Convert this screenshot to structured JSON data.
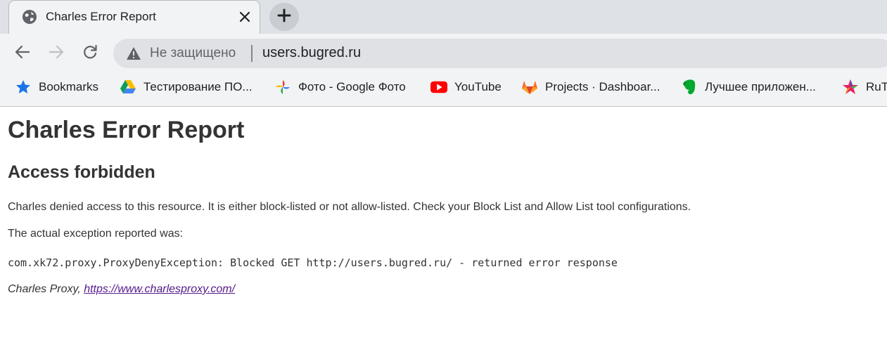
{
  "tab": {
    "title": "Charles Error Report",
    "favicon": "globe-icon",
    "close_icon": "close-icon"
  },
  "new_tab": {
    "icon": "plus-icon"
  },
  "toolbar": {
    "back_icon": "back-arrow-icon",
    "forward_icon": "forward-arrow-icon",
    "reload_icon": "reload-icon"
  },
  "omnibox": {
    "security_icon": "warning-triangle-icon",
    "security_label": "Не защищено",
    "url": "users.bugred.ru"
  },
  "bookmarks": [
    {
      "label": "Bookmarks",
      "icon": "star-icon"
    },
    {
      "label": "Тестирование ПО...",
      "icon": "google-drive-icon"
    },
    {
      "label": "Фото - Google Фото",
      "icon": "google-photos-icon"
    },
    {
      "label": "YouTube",
      "icon": "youtube-icon"
    },
    {
      "label": "Projects · Dashboar...",
      "icon": "gitlab-icon"
    },
    {
      "label": "Лучшее приложен...",
      "icon": "evernote-icon"
    },
    {
      "label": "RuTr",
      "icon": "rutracker-icon"
    }
  ],
  "page": {
    "title": "Charles Error Report",
    "heading": "Access forbidden",
    "message": "Charles denied access to this resource. It is either block-listed or not allow-listed. Check your Block List and Allow List tool configurations.",
    "exception_intro": "The actual exception reported was:",
    "exception": "com.xk72.proxy.ProxyDenyException: Blocked GET http://users.bugred.ru/ - returned error response",
    "footer_prefix": "Charles Proxy, ",
    "footer_link": "https://www.charlesproxy.com/"
  },
  "colors": {
    "tab_strip": "#dee1e6",
    "toolbar": "#f1f3f4",
    "omnibox": "#dfe1e5",
    "text": "#333333",
    "link_visited": "#551a8b"
  }
}
